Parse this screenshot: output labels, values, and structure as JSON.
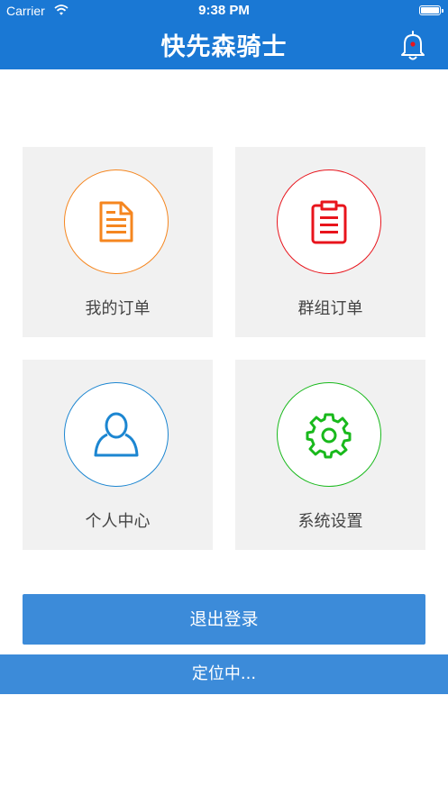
{
  "status_bar": {
    "carrier": "Carrier",
    "time": "9:38 PM"
  },
  "header": {
    "title": "快先森骑士",
    "bell_icon": "bell-icon"
  },
  "tiles": [
    {
      "label": "我的订单",
      "icon": "document-icon",
      "color": "#f5861f"
    },
    {
      "label": "群组订单",
      "icon": "clipboard-icon",
      "color": "#e8141c"
    },
    {
      "label": "个人中心",
      "icon": "user-icon",
      "color": "#1c86d1"
    },
    {
      "label": "系统设置",
      "icon": "gear-icon",
      "color": "#19b91c"
    }
  ],
  "logout_label": "退出登录",
  "location_status": "定位中...",
  "colors": {
    "header": "#1a78d4",
    "button": "#3c8bd9",
    "tile_bg": "#f1f1f1",
    "notification_dot": "#e8141c"
  }
}
